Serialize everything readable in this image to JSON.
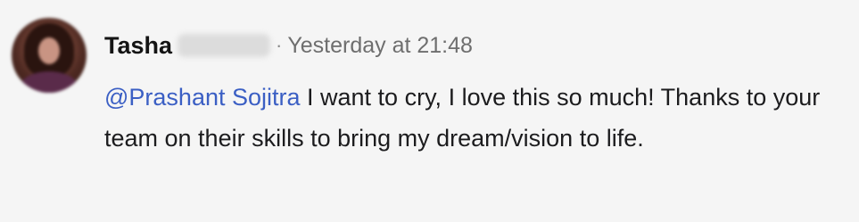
{
  "comment": {
    "author": "Tasha",
    "separator": "·",
    "timestamp": "Yesterday at 21:48",
    "mention": "@Prashant Sojitra",
    "message": " I want to cry, I love this so much! Thanks to your team on their skills to bring my dream/vision to life.",
    "avatar_icon": "user-avatar-photo",
    "colors": {
      "background": "#f5f5f5",
      "text": "#1c1c1e",
      "mention": "#3b5fc4",
      "timestamp": "#6e6e6e"
    }
  }
}
